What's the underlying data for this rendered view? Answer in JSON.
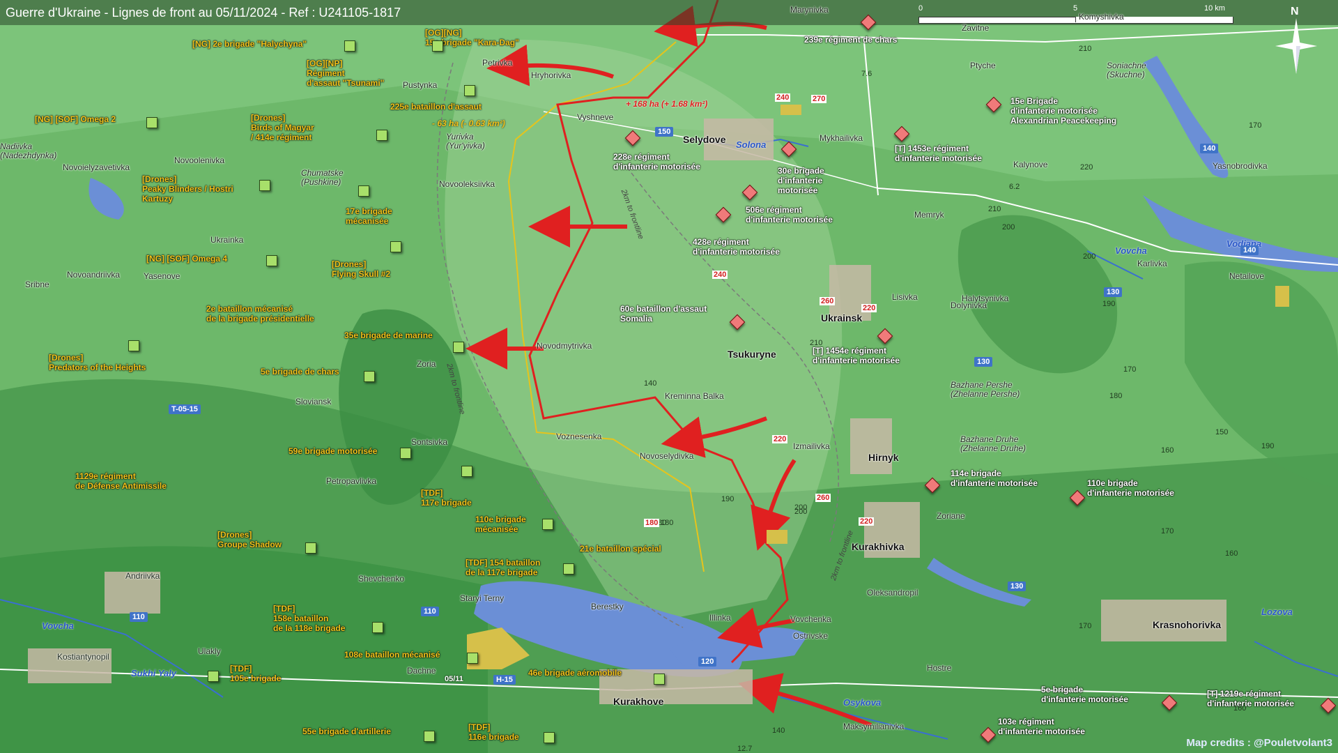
{
  "title": "Guerre d'Ukraine - Lignes de front au 05/11/2024 - Ref : U241105-1817",
  "scale": {
    "t0": "0",
    "t1": "5",
    "t2": "10 km"
  },
  "north": "N",
  "credits": "Map credits : @Pouletvolant3",
  "colors": {
    "ua_unit": "#a8e06a",
    "ru_unit": "#f07a7a",
    "front_red": "#e02020",
    "front_yellow": "#f2c21a",
    "water": "#6b8fd6"
  },
  "ua_units": [
    {
      "label": "[NG] 2e brigade \"Halychyna\""
    },
    {
      "label": "[OG][NG]\n15e brigade \"Kara-Dag\""
    },
    {
      "label": "[OG][NP]\nRégiment\nd'assaut \"Tsunami\""
    },
    {
      "label": "225e bataillon d'assaut"
    },
    {
      "label": "[NG] [SOF] Omega 2"
    },
    {
      "label": "[Drones]\nBirds of Magyar\n/ 414e régiment"
    },
    {
      "label": "[Drones]\nPeaky Blinders / Hostri\nKartuzy"
    },
    {
      "label": "17e brigade\nmécanisée"
    },
    {
      "label": "[NG] [SOF] Omega 4"
    },
    {
      "label": "[Drones]\nFlying Skull #2"
    },
    {
      "label": "2e bataillon mécanisé\nde la brigade présidentielle"
    },
    {
      "label": "35e brigade de marine"
    },
    {
      "label": "[Drones]\nPredators of the Heights"
    },
    {
      "label": "5e brigade de chars"
    },
    {
      "label": "59e brigade motorisée"
    },
    {
      "label": "1129e régiment\nde Défense Antimissile"
    },
    {
      "label": "[TDF]\n117e brigade"
    },
    {
      "label": "110e brigade\nmécanisée"
    },
    {
      "label": "[Drones]\nGroupe Shadow"
    },
    {
      "label": "21e bataillon spécial"
    },
    {
      "label": "[TDF] 154 bataillon\nde la 117e brigade"
    },
    {
      "label": "[TDF]\n158e bataillon\nde la 118e brigade"
    },
    {
      "label": "108e bataillon mécanisé"
    },
    {
      "label": "[TDF]\n105e brigade"
    },
    {
      "label": "46e brigade aéromobile"
    },
    {
      "label": "55e brigade d'artillerie"
    },
    {
      "label": "[TDF]\n116e brigade"
    }
  ],
  "ru_units": [
    {
      "label": "239e régiment de chars"
    },
    {
      "label": "15e Brigade\nd'infanterie motorisée\nAlexandrian Peacekeeping"
    },
    {
      "label": "228e régiment\nd'infanterie motorisée"
    },
    {
      "label": "30e brigade\nd'infanterie\nmotorisée"
    },
    {
      "label": "[T] 1453e régiment\nd'infanterie motorisée"
    },
    {
      "label": "506e régiment\nd'infanterie motorisée"
    },
    {
      "label": "428e régiment\nd'infanterie motorisée"
    },
    {
      "label": "60e bataillon d'assaut\nSomalia"
    },
    {
      "label": "[T] 1454e régiment\nd'infanterie motorisée"
    },
    {
      "label": "114e brigade\nd'infanterie motorisée"
    },
    {
      "label": "110e brigade\nd'infanterie motorisée"
    },
    {
      "label": "5e brigade\nd'infanterie motorisée"
    },
    {
      "label": "[T] 1219e régiment\nd'infanterie motorisée"
    },
    {
      "label": "103e régiment\nd'infanterie motorisée"
    }
  ],
  "towns": [
    {
      "name": "Marynivka"
    },
    {
      "name": "Zavitne"
    },
    {
      "name": "Komyshivka"
    },
    {
      "name": "Petrivka"
    },
    {
      "name": "Hryhorivka"
    },
    {
      "name": "Pustynka"
    },
    {
      "name": "Vyshneve"
    },
    {
      "name": "Selydove"
    },
    {
      "name": "Mykhailivka"
    },
    {
      "name": "Ptyche"
    },
    {
      "name": "Soniachne\n(Skuchne)"
    },
    {
      "name": "Yurivka\n(Yur'yivka)"
    },
    {
      "name": "Nadiivka\n(Nadezhdynka)"
    },
    {
      "name": "Novoolenivka"
    },
    {
      "name": "Novoielyzavetivka"
    },
    {
      "name": "Chumatske\n(Pushkine)"
    },
    {
      "name": "Novooleksiivka"
    },
    {
      "name": "Kalynove"
    },
    {
      "name": "Yasnobrodivka"
    },
    {
      "name": "Memryk"
    },
    {
      "name": "Ukrainka"
    },
    {
      "name": "Karlivka"
    },
    {
      "name": "Netailove"
    },
    {
      "name": "Novoandriivka"
    },
    {
      "name": "Yasenove"
    },
    {
      "name": "Sribne"
    },
    {
      "name": "Lisivka"
    },
    {
      "name": "Dolynivka"
    },
    {
      "name": "Halytsynivka"
    },
    {
      "name": "Ukrainsk"
    },
    {
      "name": "Novodmytrivka"
    },
    {
      "name": "Tsukuryne"
    },
    {
      "name": "Zoria"
    },
    {
      "name": "Sloviansk"
    },
    {
      "name": "Bazhane Pershe\n(Zhelanne Pershe)"
    },
    {
      "name": "Kreminna Balka"
    },
    {
      "name": "Voznesenka"
    },
    {
      "name": "Novoselydivka"
    },
    {
      "name": "Izmailivka"
    },
    {
      "name": "Hirnyk"
    },
    {
      "name": "Bazhane Druhe\n(Zhelanne Druhe)"
    },
    {
      "name": "Sontsivka"
    },
    {
      "name": "Petropavlivka"
    },
    {
      "name": "Zoriane"
    },
    {
      "name": "Kurakhivka"
    },
    {
      "name": "Andriivka"
    },
    {
      "name": "Shevchenko"
    },
    {
      "name": "Staryi Terny"
    },
    {
      "name": "Oleksandropil"
    },
    {
      "name": "Berestky"
    },
    {
      "name": "Illinka"
    },
    {
      "name": "Vovchenka"
    },
    {
      "name": "Ostrivske"
    },
    {
      "name": "Krasnohorivka"
    },
    {
      "name": "Kostiantynopil"
    },
    {
      "name": "Ulakly"
    },
    {
      "name": "Dachne"
    },
    {
      "name": "Kurakhove"
    },
    {
      "name": "Hostre"
    },
    {
      "name": "Maksymilianivka"
    }
  ],
  "rivers": [
    {
      "name": "Solona"
    },
    {
      "name": "Vodiana"
    },
    {
      "name": "Vovcha"
    },
    {
      "name": "Vovcha"
    },
    {
      "name": "Sukhi Yaly"
    },
    {
      "name": "Osykova"
    },
    {
      "name": "Lozova"
    }
  ],
  "roads": [
    {
      "name": "T-05-15"
    },
    {
      "name": "H-15"
    },
    {
      "name": "140"
    },
    {
      "name": "140"
    },
    {
      "name": "130"
    },
    {
      "name": "130"
    },
    {
      "name": "130"
    },
    {
      "name": "150"
    },
    {
      "name": "110"
    },
    {
      "name": "110"
    },
    {
      "name": "120"
    }
  ],
  "annotations": {
    "gain": "+ 168 ha (+ 1.68 km²)",
    "loss": "- 63 ha (- 0.63 km²)",
    "frontline1": "2km to frontline",
    "frontline2": "2km to frontline",
    "frontline3": "2km to frontline",
    "date_marker": "05/11"
  },
  "altitudes": [
    "210",
    "170",
    "220",
    "210",
    "200",
    "190",
    "180",
    "170",
    "160",
    "150",
    "200",
    "210",
    "190",
    "170",
    "180",
    "160",
    "140",
    "170",
    "160",
    "200",
    "190",
    "180",
    "140",
    "270",
    "240",
    "240",
    "260",
    "220",
    "260",
    "220",
    "220",
    "200",
    "180",
    "7.6",
    "6.2",
    "12.7"
  ]
}
